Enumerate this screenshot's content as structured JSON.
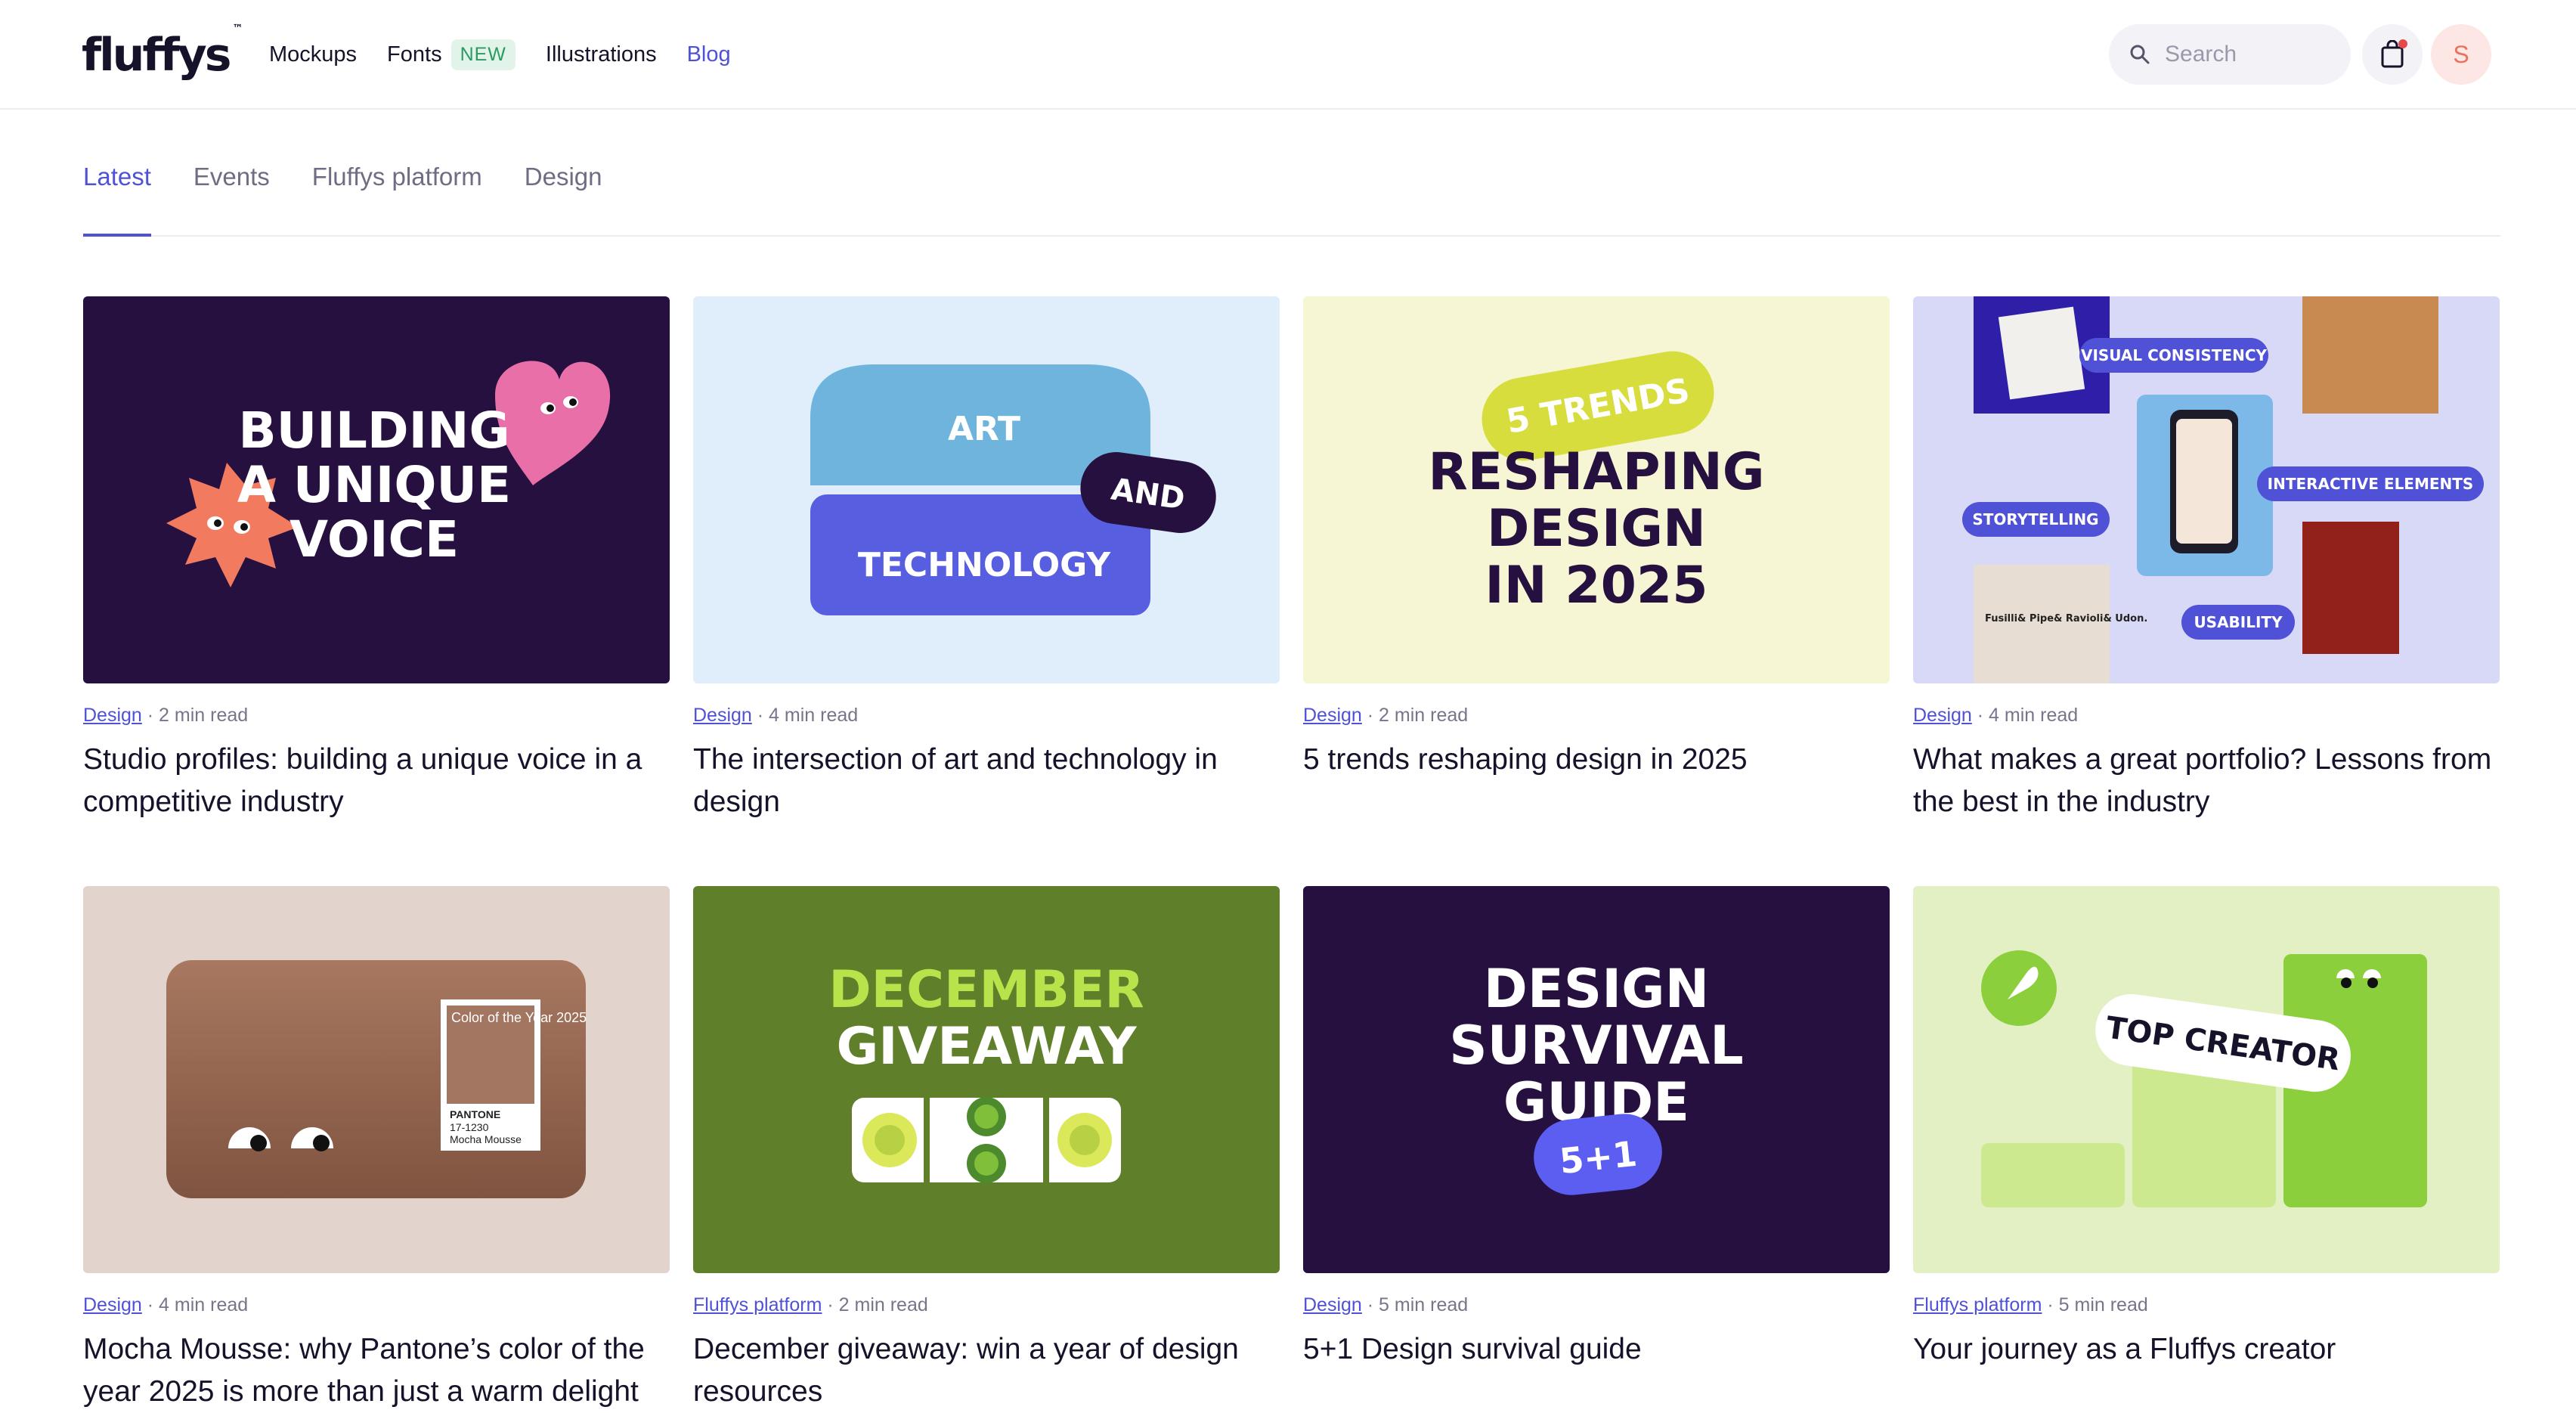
{
  "brand": {
    "logo_text": "fluffys",
    "logo_mark": "™"
  },
  "nav": {
    "mockups": "Mockups",
    "fonts": "Fonts",
    "fonts_badge": "NEW",
    "illustrations": "Illustrations",
    "blog": "Blog"
  },
  "search": {
    "placeholder": "Search"
  },
  "user": {
    "initial": "S"
  },
  "tabs": [
    "Latest",
    "Events",
    "Fluffys platform",
    "Design"
  ],
  "colors": {
    "accent": "#4f51d6",
    "text": "#15122a",
    "muted": "#77758a"
  },
  "posts": [
    {
      "category": "Design",
      "read_time": "2 min read",
      "title": "Studio profiles: building a unique voice in a competitive industry",
      "art": [
        "BUILDING",
        "A UNIQUE",
        "VOICE"
      ]
    },
    {
      "category": "Design",
      "read_time": "4 min read",
      "title": "The intersection of art and technology in design",
      "art": [
        "ART",
        "AND",
        "TECHNOLOGY"
      ]
    },
    {
      "category": "Design",
      "read_time": "2 min read",
      "title": "5 trends reshaping design in 2025",
      "art": [
        "5 TRENDS",
        "RESHAPING",
        "DESIGN",
        "IN 2025"
      ]
    },
    {
      "category": "Design",
      "read_time": "4 min read",
      "title": "What makes a great portfolio? Lessons from the best in the industry",
      "art": [
        "VISUAL CONSISTENCY",
        "INTERACTIVE ELEMENTS",
        "STORYTELLING",
        "USABILITY",
        "Fusilli& Pipe& Ravioli& Udon."
      ]
    },
    {
      "category": "Design",
      "read_time": "4 min read",
      "title": "Mocha Mousse: why Pantone’s color of the year 2025 is more than just a warm delight",
      "art": [
        "Color of the Year 2025",
        "PANTONE",
        "17-1230",
        "Mocha Mousse"
      ]
    },
    {
      "category": "Fluffys platform",
      "read_time": "2 min read",
      "title": "December giveaway: win a year of design resources",
      "art": [
        "DECEMBER",
        "GIVEAWAY"
      ]
    },
    {
      "category": "Design",
      "read_time": "5 min read",
      "title": "5+1 Design survival guide",
      "art": [
        "DESIGN",
        "SURVIVAL",
        "GUIDE",
        "5+1"
      ]
    },
    {
      "category": "Fluffys platform",
      "read_time": "5 min read",
      "title": "Your journey as a Fluffys creator",
      "art": [
        "TOP CREATOR"
      ]
    }
  ]
}
